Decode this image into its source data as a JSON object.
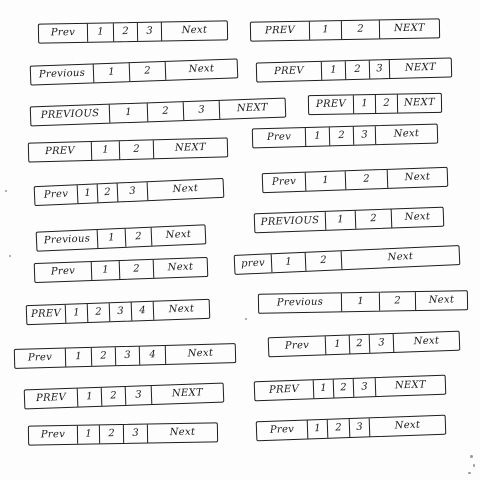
{
  "sketches": [
    {
      "id": "L1",
      "cells": [
        "Prev",
        "1",
        "2",
        "3",
        "Next"
      ]
    },
    {
      "id": "L2",
      "cells": [
        "Previous",
        "1",
        "2",
        "Next"
      ]
    },
    {
      "id": "L3",
      "cells": [
        "PREVIOUS",
        "1",
        "2",
        "3",
        "NEXT"
      ]
    },
    {
      "id": "L4",
      "cells": [
        "PREV",
        "1",
        "2",
        "NEXT"
      ]
    },
    {
      "id": "L5",
      "cells": [
        "Prev",
        "1",
        "2",
        "3",
        "Next"
      ]
    },
    {
      "id": "L6",
      "cells": [
        "Previous",
        "1",
        "2",
        "Next"
      ]
    },
    {
      "id": "L7",
      "cells": [
        "Prev",
        "1",
        "2",
        "Next"
      ]
    },
    {
      "id": "L8",
      "cells": [
        "PREV",
        "1",
        "2",
        "3",
        "4",
        "Next"
      ]
    },
    {
      "id": "L9",
      "cells": [
        "Prev",
        "1",
        "2",
        "3",
        "4",
        "Next"
      ]
    },
    {
      "id": "L10",
      "cells": [
        "PREV",
        "1",
        "2",
        "3",
        "NEXT"
      ]
    },
    {
      "id": "L11",
      "cells": [
        "Prev",
        "1",
        "2",
        "3",
        "Next"
      ]
    },
    {
      "id": "R1",
      "cells": [
        "PREV",
        "1",
        "2",
        "NEXT"
      ]
    },
    {
      "id": "R2",
      "cells": [
        "PREV",
        "1",
        "2",
        "3",
        "NEXT"
      ]
    },
    {
      "id": "R3",
      "cells": [
        "PREV",
        "1",
        "2",
        "NEXT"
      ]
    },
    {
      "id": "R4",
      "cells": [
        "Prev",
        "1",
        "2",
        "3",
        "Next"
      ]
    },
    {
      "id": "R5",
      "cells": [
        "Prev",
        "1",
        "2",
        "Next"
      ]
    },
    {
      "id": "R6",
      "cells": [
        "PREVIOUS",
        "1",
        "2",
        "Next"
      ]
    },
    {
      "id": "R7",
      "cells": [
        "prev",
        "1",
        "2",
        "Next"
      ]
    },
    {
      "id": "R8",
      "cells": [
        "Previous",
        "1",
        "2",
        "Next"
      ]
    },
    {
      "id": "R9",
      "cells": [
        "Prev",
        "1",
        "2",
        "3",
        "Next"
      ]
    },
    {
      "id": "R10",
      "cells": [
        "PREV",
        "1",
        "2",
        "3",
        "NEXT"
      ]
    },
    {
      "id": "R11",
      "cells": [
        "Prev",
        "1",
        "2",
        "3",
        "Next"
      ]
    }
  ]
}
